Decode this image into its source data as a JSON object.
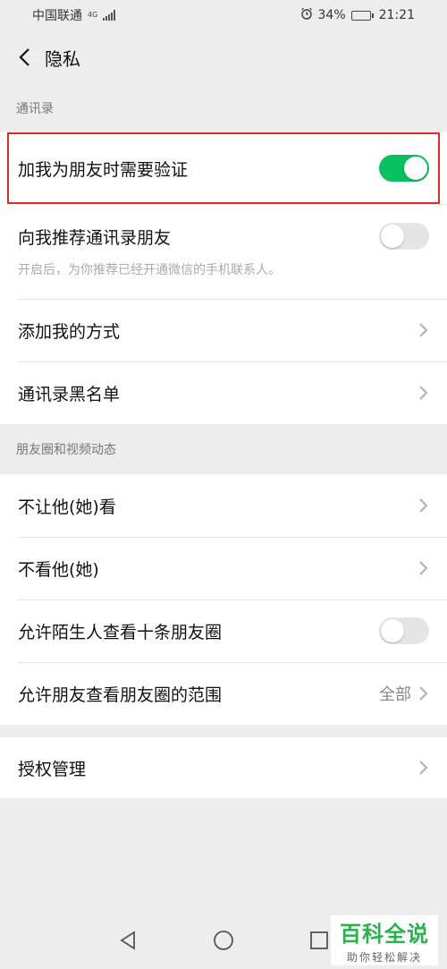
{
  "status": {
    "carrier": "中国联通",
    "network": "4G",
    "battery": "34%",
    "battery_level": 0.34,
    "time": "21:21"
  },
  "header": {
    "title": "隐私"
  },
  "sections": {
    "contacts": {
      "label": "通讯录",
      "verify": {
        "label": "加我为朋友时需要验证",
        "on": true
      },
      "recommend": {
        "label": "向我推荐通讯录朋友",
        "desc": "开启后，为你推荐已经开通微信的手机联系人。",
        "on": false
      },
      "add_methods": {
        "label": "添加我的方式"
      },
      "blacklist": {
        "label": "通讯录黑名单"
      }
    },
    "moments": {
      "label": "朋友圈和视频动态",
      "hide_from": {
        "label": "不让他(她)看"
      },
      "dont_see": {
        "label": "不看他(她)"
      },
      "strangers": {
        "label": "允许陌生人查看十条朋友圈",
        "on": false
      },
      "range": {
        "label": "允许朋友查看朋友圈的范围",
        "value": "全部"
      }
    },
    "auth": {
      "label": "授权管理"
    }
  },
  "colors": {
    "accent": "#07c160",
    "highlight": "#d62d2d"
  },
  "watermark": {
    "main": "百科全说",
    "sub": "助你轻松解决"
  }
}
